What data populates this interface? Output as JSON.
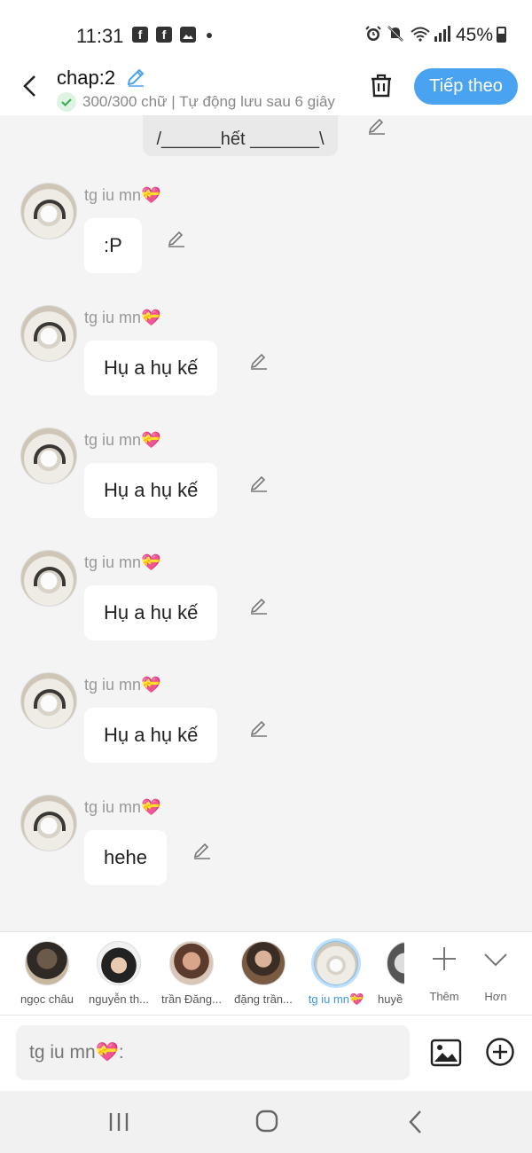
{
  "status_bar": {
    "time": "11:31",
    "app_icons": [
      "facebook-icon",
      "facebook-icon",
      "gallery-icon"
    ],
    "battery": "45%"
  },
  "header": {
    "title": "chap:2",
    "subtitle": "300/300 chữ | Tự động lưu sau 6 giây",
    "next_label": "Tiếp theo"
  },
  "previous_message": {
    "text": "/______hết _______\\"
  },
  "messages": [
    {
      "author": "tg iu mn💝",
      "text": ":P"
    },
    {
      "author": "tg iu mn💝",
      "text": "Hụ a hụ kế"
    },
    {
      "author": "tg iu mn💝",
      "text": "Hụ a hụ kế"
    },
    {
      "author": "tg iu mn💝",
      "text": "Hụ a hụ kế"
    },
    {
      "author": "tg iu mn💝",
      "text": "Hụ a hụ kế"
    },
    {
      "author": "tg iu mn💝",
      "text": "hehe"
    }
  ],
  "characters": [
    {
      "name": "ngọc châu",
      "selected": false
    },
    {
      "name": "nguyễn th...",
      "selected": false
    },
    {
      "name": "trần Đăng...",
      "selected": false
    },
    {
      "name": "đặng trần...",
      "selected": false
    },
    {
      "name": "tg iu mn💝",
      "selected": true
    },
    {
      "name": "huyề",
      "selected": false
    }
  ],
  "tools": {
    "add_label": "Thêm",
    "more_label": "Hơn"
  },
  "input": {
    "placeholder": "tg iu mn💝:"
  },
  "colors": {
    "accent": "#4aa3f0",
    "background": "#f4f4f4"
  }
}
